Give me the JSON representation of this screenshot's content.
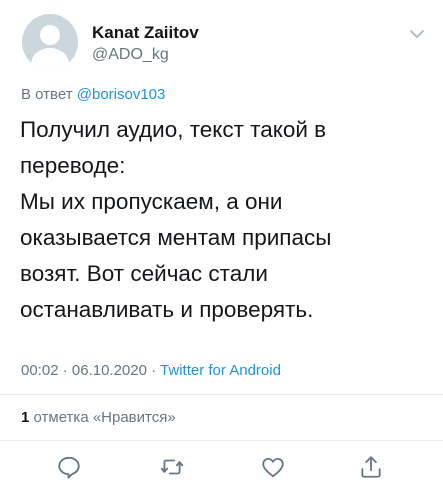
{
  "user": {
    "name": "Kanat Zaiitov",
    "handle": "@ADO_kg"
  },
  "reply": {
    "prefix": "В ответ",
    "mention": "@borisov103"
  },
  "tweet": {
    "lines": [
      "Получил аудио, текст такой в",
      "переводе:",
      "Мы их пропускаем, а они",
      "оказывается ментам припасы",
      "возят. Вот сейчас стали",
      "останавливать и проверять."
    ]
  },
  "meta": {
    "time": "00:02",
    "date": "06.10.2020",
    "separator": "·",
    "source": "Twitter for Android"
  },
  "likes": {
    "count": "1",
    "label": "отметка «Нравится»"
  },
  "actions": {
    "icons": [
      "reply-icon",
      "retweet-icon",
      "like-icon",
      "share-icon"
    ]
  },
  "colors": {
    "text": "#14171a",
    "secondary": "#657786",
    "link": "#1b95e0",
    "divider": "#e6ecf0",
    "icon": "#657786"
  }
}
